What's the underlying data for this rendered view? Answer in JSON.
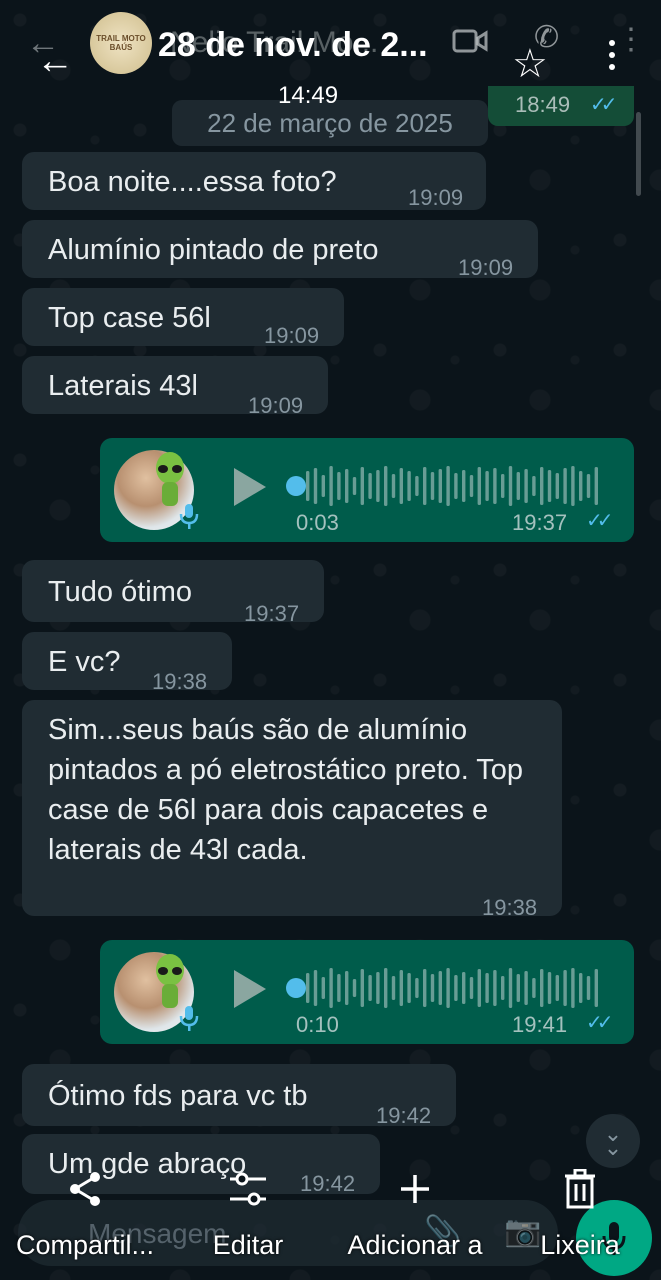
{
  "header": {
    "back_ghost": "←",
    "back": "←",
    "avatar_text": "TRAIL MOTO BAÚS",
    "contact_ghost": "Nelio Trail Mo...",
    "viewer_title": "28 de nov. de 2...",
    "viewer_time": "14:49",
    "star_icon": "☆",
    "call_icon": "✆",
    "menu_ghost": "⋮"
  },
  "chat": {
    "previous_out_time": "18:49",
    "ticks": "✓✓",
    "date_chip": "22 de março de 2025",
    "messages": [
      {
        "text": "Boa noite....essa foto?",
        "time": "19:09"
      },
      {
        "text": "Alumínio pintado de preto",
        "time": "19:09"
      },
      {
        "text": "Top case 56l",
        "time": "19:09"
      },
      {
        "text": "Laterais 43l",
        "time": "19:09"
      },
      {
        "text": "Tudo ótimo",
        "time": "19:37"
      },
      {
        "text": "E vc?",
        "time": "19:38"
      },
      {
        "text": "Sim...seus baús são de alumínio pintados a pó eletrostático preto. Top case de 56l para dois capacetes e laterais de 43l cada.",
        "time": "19:38"
      },
      {
        "text": "Ótimo fds para vc tb",
        "time": "19:42"
      },
      {
        "text": "Um gde abraço",
        "time": "19:42"
      }
    ],
    "voice_notes": [
      {
        "duration": "0:03",
        "time": "19:37"
      },
      {
        "duration": "0:10",
        "time": "19:41"
      }
    ]
  },
  "composer": {
    "placeholder": "Mensagem",
    "clip_icon": "📎",
    "cam_icon": "📷"
  },
  "actions": [
    {
      "label": "Compartil...",
      "icon": "share-icon"
    },
    {
      "label": "Editar",
      "icon": "edit-icon"
    },
    {
      "label": "Adicionar a",
      "icon": "add-icon"
    },
    {
      "label": "Lixeira",
      "icon": "trash-icon"
    }
  ],
  "colors": {
    "background": "#0b141a",
    "incoming_bubble": "#202c33",
    "outgoing_bubble": "#005c4b",
    "read_ticks": "#53bdeb",
    "accent": "#00a884"
  }
}
